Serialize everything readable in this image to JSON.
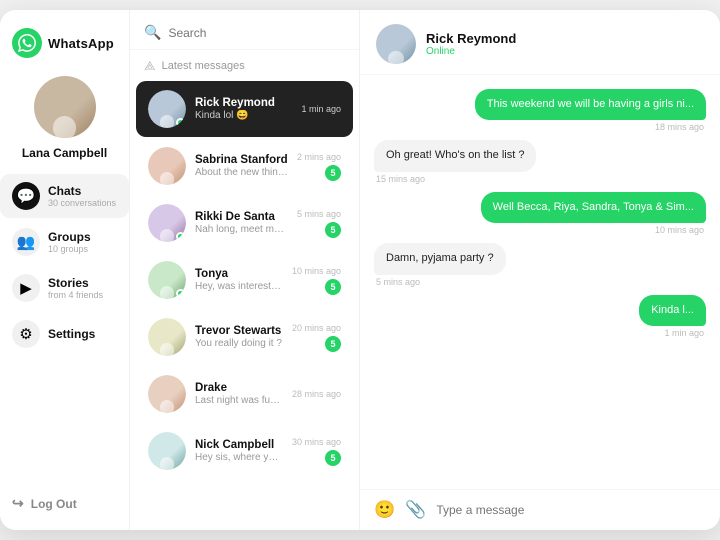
{
  "app": {
    "name": "WhatsApp",
    "logo_icon": "💬"
  },
  "sidebar": {
    "user": {
      "name": "Lana Campbell"
    },
    "nav_items": [
      {
        "id": "chats",
        "label": "Chats",
        "sub": "30 conversations",
        "icon": "💬",
        "active": true
      },
      {
        "id": "groups",
        "label": "Groups",
        "sub": "10 groups",
        "icon": "👥",
        "active": false
      },
      {
        "id": "stories",
        "label": "Stories",
        "sub": "from 4 friends",
        "icon": "▶",
        "active": false
      },
      {
        "id": "settings",
        "label": "Settings",
        "sub": "",
        "icon": "⚙",
        "active": false
      }
    ],
    "logout_label": "Log Out"
  },
  "chat_list": {
    "search_placeholder": "Search",
    "filter_label": "Latest messages",
    "items": [
      {
        "id": 1,
        "name": "Rick Reymond",
        "preview": "Kinda lol 😄",
        "time": "1 min ago",
        "unread": 0,
        "online": true,
        "active": true,
        "avatar_class": "av-rick"
      },
      {
        "id": 2,
        "name": "Sabrina Stanford",
        "preview": "About the new things at my office...",
        "time": "2 mins ago",
        "unread": 5,
        "online": false,
        "active": false,
        "avatar_class": "av-sabrina"
      },
      {
        "id": 3,
        "name": "Rikki De Santa",
        "preview": "Nah long, meet me soon bae ❤",
        "time": "5 mins ago",
        "unread": 5,
        "online": true,
        "active": false,
        "avatar_class": "av-rikki"
      },
      {
        "id": 4,
        "name": "Tonya",
        "preview": "Hey, was interested in the opportu...",
        "time": "10 mins ago",
        "unread": 5,
        "online": true,
        "active": false,
        "avatar_class": "av-tonya"
      },
      {
        "id": 5,
        "name": "Trevor Stewarts",
        "preview": "You really doing it ?",
        "time": "20 mins ago",
        "unread": 5,
        "online": false,
        "active": false,
        "avatar_class": "av-trevor"
      },
      {
        "id": 6,
        "name": "Drake",
        "preview": "Last night was funn 😄",
        "time": "28 mins ago",
        "unread": 0,
        "online": false,
        "active": false,
        "avatar_class": "av-drake"
      },
      {
        "id": 7,
        "name": "Nick Campbell",
        "preview": "Hey sis, where you at ?",
        "time": "30 mins ago",
        "unread": 5,
        "online": false,
        "active": false,
        "avatar_class": "av-nick"
      }
    ]
  },
  "chat_window": {
    "contact_name": "Rick Reymond",
    "contact_status": "Online",
    "messages": [
      {
        "id": 1,
        "text": "This weekend we will be having a girls ni...",
        "time": "18 mins ago",
        "type": "outgoing"
      },
      {
        "id": 2,
        "text": "Oh great! Who's on the list ?",
        "time": "15 mins ago",
        "type": "incoming"
      },
      {
        "id": 3,
        "text": "Well Becca, Riya, Sandra, Tonya & Sim...",
        "time": "10 mins ago",
        "type": "outgoing"
      },
      {
        "id": 4,
        "text": "Damn, pyjama party ?",
        "time": "5 mins ago",
        "type": "incoming"
      },
      {
        "id": 5,
        "text": "Kinda l...",
        "time": "1 min ago",
        "type": "outgoing"
      }
    ],
    "input_placeholder": "Type a message"
  }
}
